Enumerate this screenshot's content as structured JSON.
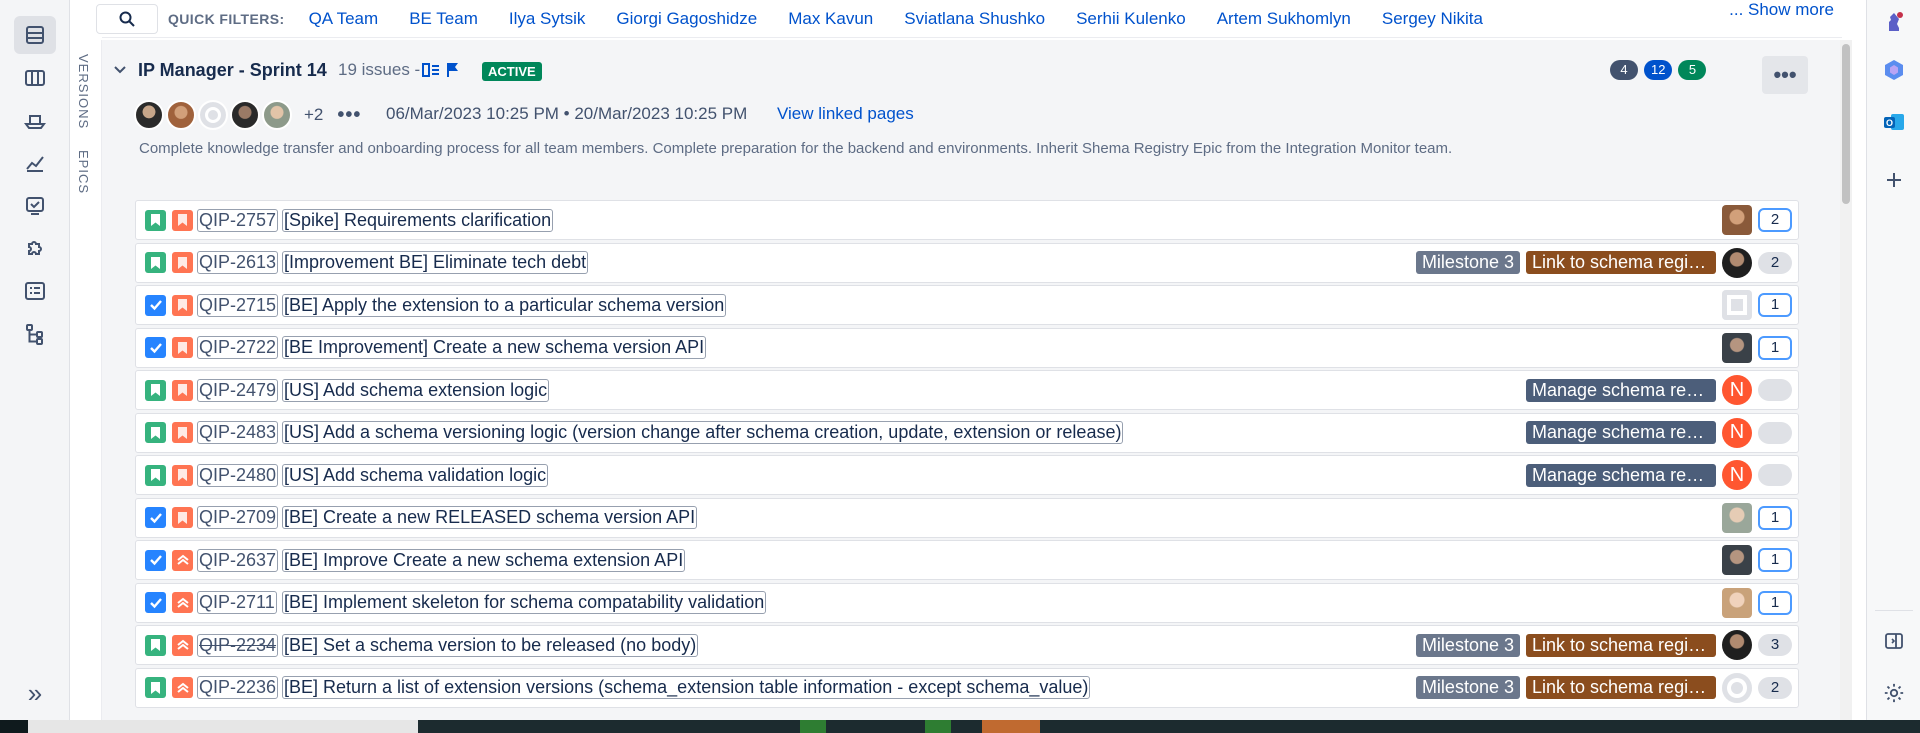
{
  "filters": {
    "label": "QUICK FILTERS:",
    "items": [
      "QA Team",
      "BE Team",
      "Ilya Sytsik",
      "Giorgi Gagoshidze",
      "Max Kavun",
      "Sviatlana Shushko",
      "Serhii Kulenko",
      "Artem Sukhomlyn",
      "Sergey Nikita"
    ],
    "show_more": "... Show more"
  },
  "vtabs": {
    "versions": "VERSIONS",
    "epics": "EPICS"
  },
  "sprint": {
    "title": "IP Manager - Sprint 14",
    "issue_count": "19 issues -",
    "status": "ACTIVE",
    "counts": [
      {
        "value": "4",
        "color": "#42526e"
      },
      {
        "value": "12",
        "color": "#0052cc"
      },
      {
        "value": "5",
        "color": "#00875a"
      }
    ],
    "more": "•••",
    "avatars_extra": "+2",
    "avatar_more": "•••",
    "dates": "06/Mar/2023 10:25 PM  •  20/Mar/2023 10:25 PM",
    "linked_pages": "View linked pages",
    "goal": "Complete knowledge transfer and onboarding process for all team members. Complete preparation for the backend and environments. Inherit Shema Registry Epic from the Integration Monitor team."
  },
  "issues": [
    {
      "type": "story",
      "priority": "high",
      "key": "QIP-2757",
      "summary": "[Spike] Requirements clarification",
      "milestone": "",
      "epic": "",
      "epic_style": "",
      "assignee": "photo-a",
      "estimate": "2",
      "estimate_style": "box",
      "done": false
    },
    {
      "type": "story",
      "priority": "high",
      "key": "QIP-2613",
      "summary": "[Improvement BE] Eliminate tech debt",
      "milestone": "Milestone 3",
      "epic": "Link to schema regis...",
      "epic_style": "link",
      "assignee": "photo-b",
      "estimate": "2",
      "estimate_style": "pill",
      "done": false
    },
    {
      "type": "task",
      "priority": "high",
      "key": "QIP-2715",
      "summary": "[BE] Apply the extension to a particular schema version",
      "milestone": "",
      "epic": "",
      "epic_style": "",
      "assignee": "blank",
      "estimate": "1",
      "estimate_style": "box",
      "done": false
    },
    {
      "type": "task",
      "priority": "high",
      "key": "QIP-2722",
      "summary": "[BE Improvement] Create a new schema version API",
      "milestone": "",
      "epic": "",
      "epic_style": "",
      "assignee": "photo-c",
      "estimate": "1",
      "estimate_style": "box",
      "done": false
    },
    {
      "type": "story",
      "priority": "high",
      "key": "QIP-2479",
      "summary": "[US] Add schema extension logic",
      "milestone": "",
      "epic": "Manage schema regi...",
      "epic_style": "manage",
      "assignee": "n",
      "estimate": "",
      "estimate_style": "pill",
      "done": false
    },
    {
      "type": "story",
      "priority": "high",
      "key": "QIP-2483",
      "summary": "[US] Add a schema versioning logic (version change after schema creation, update, extension or release)",
      "milestone": "",
      "epic": "Manage schema regi...",
      "epic_style": "manage",
      "assignee": "n",
      "estimate": "",
      "estimate_style": "pill",
      "done": false
    },
    {
      "type": "story",
      "priority": "high",
      "key": "QIP-2480",
      "summary": "[US] Add schema validation logic",
      "milestone": "",
      "epic": "Manage schema regi...",
      "epic_style": "manage",
      "assignee": "n",
      "estimate": "",
      "estimate_style": "pill",
      "done": false
    },
    {
      "type": "task",
      "priority": "high",
      "key": "QIP-2709",
      "summary": "[BE] Create a new RELEASED schema version API",
      "milestone": "",
      "epic": "",
      "epic_style": "",
      "assignee": "photo-d",
      "estimate": "1",
      "estimate_style": "box",
      "done": false
    },
    {
      "type": "task",
      "priority": "highest",
      "key": "QIP-2637",
      "summary": "[BE] Improve Create a new schema extension API",
      "milestone": "",
      "epic": "",
      "epic_style": "",
      "assignee": "photo-c",
      "estimate": "1",
      "estimate_style": "box",
      "done": false
    },
    {
      "type": "task",
      "priority": "highest",
      "key": "QIP-2711",
      "summary": "[BE] Implement skeleton for schema compatability validation",
      "milestone": "",
      "epic": "",
      "epic_style": "",
      "assignee": "photo-e",
      "estimate": "1",
      "estimate_style": "box",
      "done": false
    },
    {
      "type": "story",
      "priority": "highest",
      "key": "QIP-2234",
      "summary": "[BE] Set a schema version to be released (no body)",
      "milestone": "Milestone 3",
      "epic": "Link to schema regis...",
      "epic_style": "link",
      "assignee": "photo-b",
      "estimate": "3",
      "estimate_style": "pill",
      "done": true
    },
    {
      "type": "story",
      "priority": "highest",
      "key": "QIP-2236",
      "summary": "[BE] Return a list of extension versions (schema_extension table information - except schema_value)",
      "milestone": "Milestone 3",
      "epic": "Link to schema regis...",
      "epic_style": "link",
      "assignee": "blank",
      "estimate": "2",
      "estimate_style": "pill",
      "done": false
    }
  ],
  "colors": {
    "story": "#36b37e",
    "task": "#2684ff",
    "priority": "#ff7452",
    "link": "#0052cc",
    "active": "#00875a"
  }
}
